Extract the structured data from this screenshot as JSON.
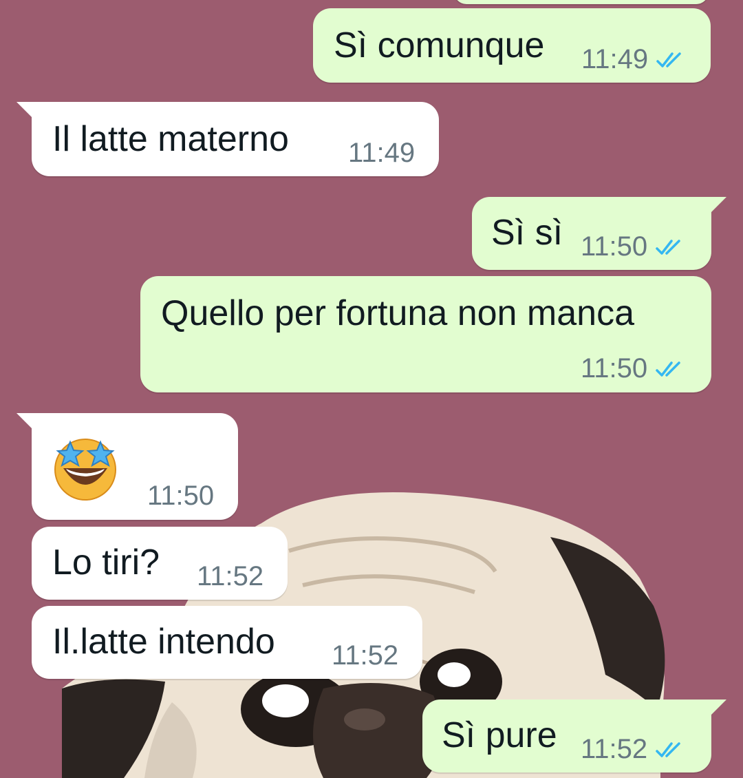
{
  "colors": {
    "background": "#9c5c6f",
    "outgoing_bubble": "#e2fdd0",
    "incoming_bubble": "#ffffff",
    "timestamp": "#667781",
    "read_ticks": "#34b7f1"
  },
  "messages": [
    {
      "direction": "outgoing",
      "text": "Sì comunque",
      "time": "11:49",
      "status": "read"
    },
    {
      "direction": "incoming",
      "text": "Il latte materno",
      "time": "11:49"
    },
    {
      "direction": "outgoing",
      "text": "Sì sì",
      "time": "11:50",
      "status": "read"
    },
    {
      "direction": "outgoing",
      "text": "Quello per fortuna non manca",
      "time": "11:50",
      "status": "read"
    },
    {
      "direction": "incoming",
      "emoji": "star-struck-emoji",
      "time": "11:50"
    },
    {
      "direction": "incoming",
      "text": "Lo tiri?",
      "time": "11:52"
    },
    {
      "direction": "incoming",
      "text": "Il.latte intendo",
      "time": "11:52"
    },
    {
      "direction": "outgoing",
      "text": "Sì pure",
      "time": "11:52",
      "status": "read"
    }
  ]
}
